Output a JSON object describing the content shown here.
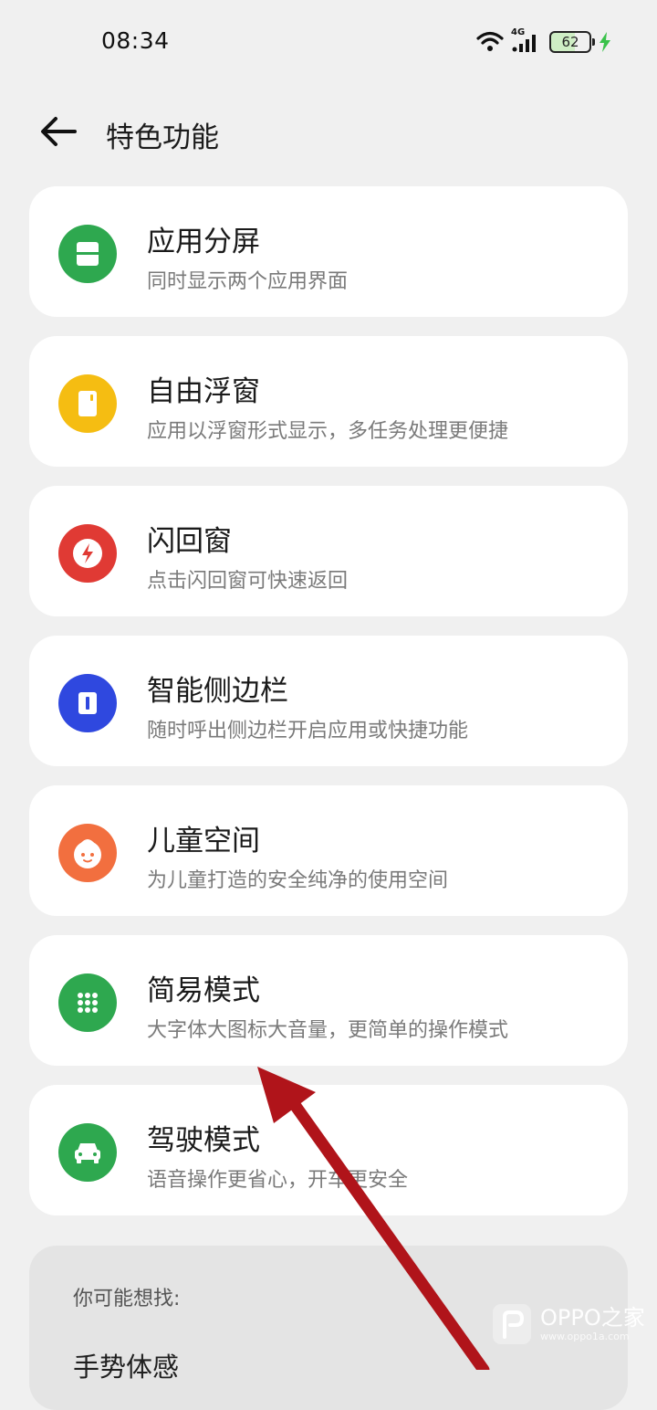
{
  "status_bar": {
    "time": "08:34",
    "network": "4G",
    "battery": "62"
  },
  "header": {
    "title": "特色功能"
  },
  "features": [
    {
      "title": "应用分屏",
      "subtitle": "同时显示两个应用界面",
      "icon": "split-screen-icon",
      "color": "#2ea84f"
    },
    {
      "title": "自由浮窗",
      "subtitle": "应用以浮窗形式显示，多任务处理更便捷",
      "icon": "floating-window-icon",
      "color": "#f5bd12"
    },
    {
      "title": "闪回窗",
      "subtitle": "点击闪回窗可快速返回",
      "icon": "flashback-icon",
      "color": "#e03a34"
    },
    {
      "title": "智能侧边栏",
      "subtitle": "随时呼出侧边栏开启应用或快捷功能",
      "icon": "sidebar-icon",
      "color": "#2f48df"
    },
    {
      "title": "儿童空间",
      "subtitle": "为儿童打造的安全纯净的使用空间",
      "icon": "kid-face-icon",
      "color": "#f26f3f"
    },
    {
      "title": "简易模式",
      "subtitle": "大字体大图标大音量，更简单的操作模式",
      "icon": "grid-dots-icon",
      "color": "#2ea84f"
    },
    {
      "title": "驾驶模式",
      "subtitle": "语音操作更省心，开车更安全",
      "icon": "car-icon",
      "color": "#2ea84f"
    }
  ],
  "suggestions": {
    "label": "你可能想找:",
    "items": [
      "手势体感"
    ]
  },
  "watermark": {
    "brand": "OPPO之家",
    "url": "www.oppo1a.com"
  },
  "annotation": {
    "color": "#b0141a"
  }
}
